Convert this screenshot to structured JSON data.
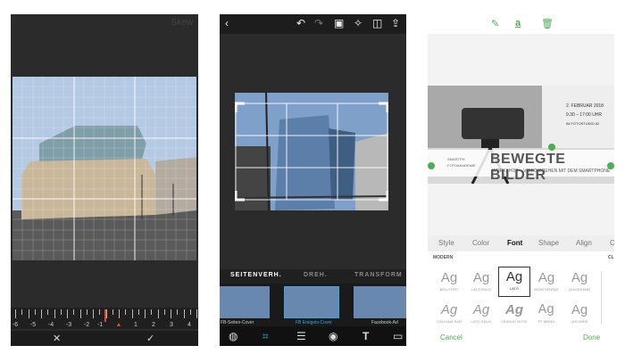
{
  "panel1": {
    "title": "Skew",
    "ruler_labels": [
      "-6",
      "-5",
      "-4",
      "-3",
      "-2",
      "-1",
      "0",
      "1",
      "2",
      "3",
      "4"
    ],
    "cancel": "✕",
    "confirm": "✓"
  },
  "panel2": {
    "tabs": [
      "SEITENVERH.",
      "DREH.",
      "TRANSFORM"
    ],
    "presets": [
      "FB-Seiten-Cover",
      "FB Ereignis-Cover",
      "Facebook-Ad"
    ],
    "top_icons": [
      "back-icon",
      "undo-icon",
      "redo-icon",
      "compare-icon",
      "magic-wand-icon",
      "split-view-icon",
      "share-icon"
    ],
    "bottom_tools": [
      "looks-icon",
      "crop-icon",
      "adjust-icon",
      "eye-icon",
      "text-icon",
      "border-icon"
    ]
  },
  "panel3": {
    "poster": {
      "date": "2. FEBRUAR 2018",
      "time": "9.30 – 17:00 UHR",
      "place": "IM FOTOSTUDIO 62",
      "headline": "BEWEGTE BILDER",
      "subline": "WORKSHOP – VIDEO DREHEN MIT DEM SMARTPHONE",
      "logo_line1": "SMARTPH",
      "logo_line2": "FOTOAKADEMIE"
    },
    "tabs": [
      "Style",
      "Color",
      "Font",
      "Shape",
      "Align",
      "C"
    ],
    "active_tab": "Font",
    "section": "MODERN",
    "section_right": "CL",
    "fonts": [
      "BELLFORT",
      "LATO BOLD",
      "LATO",
      "MONTSERRAT",
      "QUICKSAND",
      "CALLUNA SAN",
      "LATO ITALIC",
      "LEAGUE GOTH",
      "PT MONO",
      "VOLTAIRE"
    ],
    "sample": "Ag",
    "selected_font": "LATO",
    "cancel": "Cancel",
    "done": "Done",
    "accent": "#4caf50"
  }
}
